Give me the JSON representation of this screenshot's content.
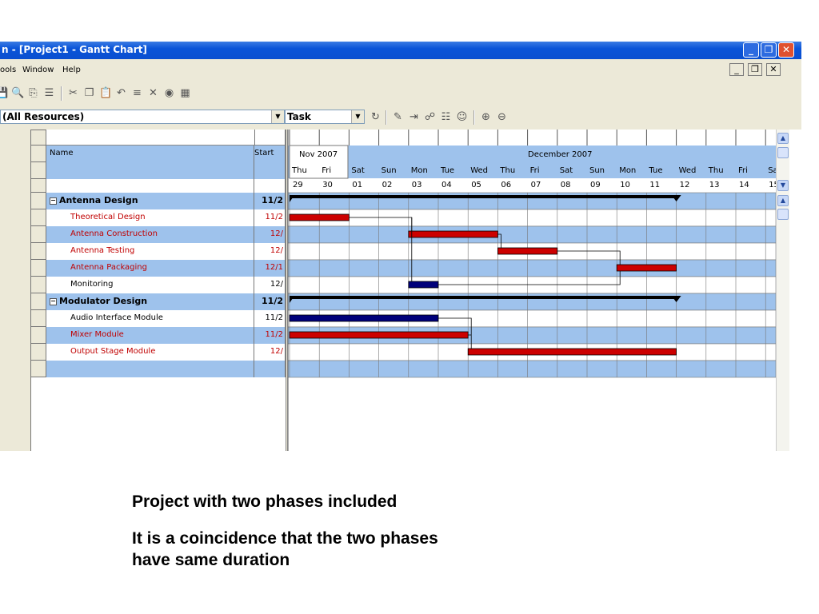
{
  "window": {
    "title": "n - [Project1 - Gantt Chart]",
    "minimize_label": "_",
    "maximize_label": "❐",
    "close_label": "✕"
  },
  "menu": {
    "items": [
      "ools",
      "Window",
      "Help"
    ],
    "mdi_min": "_",
    "mdi_restore": "❐",
    "mdi_close": "✕"
  },
  "filter": {
    "resources": "(All Resources)",
    "group": "Task"
  },
  "table": {
    "columns": [
      "Name",
      "Start"
    ],
    "rows": [
      {
        "name": "Antenna Design",
        "start": "11/2",
        "type": "phase"
      },
      {
        "name": "Theoretical Design",
        "start": "11/2",
        "type": "critical"
      },
      {
        "name": "Antenna Construction",
        "start": "12/",
        "type": "critical"
      },
      {
        "name": "Antenna Testing",
        "start": "12/",
        "type": "critical"
      },
      {
        "name": "Antenna Packaging",
        "start": "12/1",
        "type": "critical"
      },
      {
        "name": "Monitoring",
        "start": "12/",
        "type": "normal"
      },
      {
        "name": "Modulator Design",
        "start": "11/2",
        "type": "phase"
      },
      {
        "name": "Audio Interface Module",
        "start": "11/2",
        "type": "normal"
      },
      {
        "name": "Mixer Module",
        "start": "11/2",
        "type": "critical"
      },
      {
        "name": "Output Stage Module",
        "start": "12/",
        "type": "critical"
      }
    ]
  },
  "gantt": {
    "months": [
      "Nov 2007",
      "December 2007"
    ],
    "weekdays": [
      "Thu",
      "Fri",
      "Sat",
      "Sun",
      "Mon",
      "Tue",
      "Wed",
      "Thu",
      "Fri",
      "Sat",
      "Sun",
      "Mon",
      "Tue",
      "Wed",
      "Thu",
      "Fri",
      "Sa"
    ],
    "days": [
      "29",
      "30",
      "01",
      "02",
      "03",
      "04",
      "05",
      "06",
      "07",
      "08",
      "09",
      "10",
      "11",
      "12",
      "13",
      "14",
      "15"
    ],
    "critical_color": "#cc0000",
    "normal_color": "#00007a",
    "row_blue": "#9ec2ec"
  },
  "caption": {
    "line1": "Project with two phases included",
    "line2": "It is a coincidence that the two phases",
    "line3": "have same duration"
  }
}
